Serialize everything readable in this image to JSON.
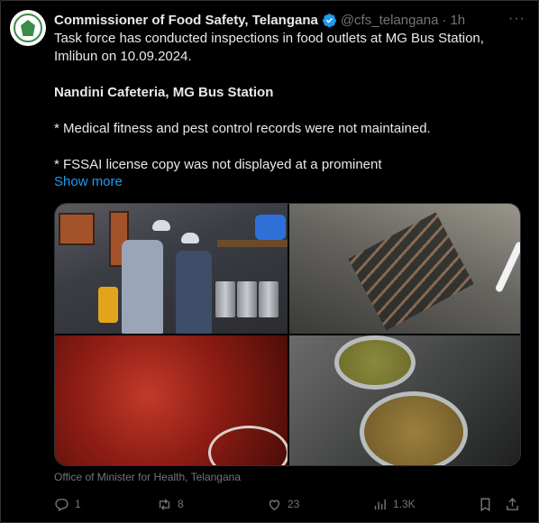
{
  "author": {
    "name": "Commissioner of Food Safety, Telangana",
    "handle": "@cfs_telangana",
    "separator": "·",
    "time": "1h",
    "verified_color": "#1d9bf0"
  },
  "more_label": "···",
  "text": {
    "line1": "Task force has conducted inspections in food outlets at MG Bus Station, Imlibun on 10.09.2024.",
    "heading": "Nandini Cafeteria, MG Bus Station",
    "point1": "* Medical fitness and pest control records were not maintained.",
    "point2": "* FSSAI license copy was not displayed at a prominent"
  },
  "show_more": "Show more",
  "media_caption": "Office of Minister for Health, Telangana",
  "actions": {
    "replies": "1",
    "reposts": "8",
    "likes": "23",
    "views": "1.3K"
  },
  "icons": [
    "more-icon",
    "verified-icon",
    "reply-icon",
    "repost-icon",
    "like-icon",
    "views-icon",
    "bookmark-icon",
    "share-icon"
  ]
}
